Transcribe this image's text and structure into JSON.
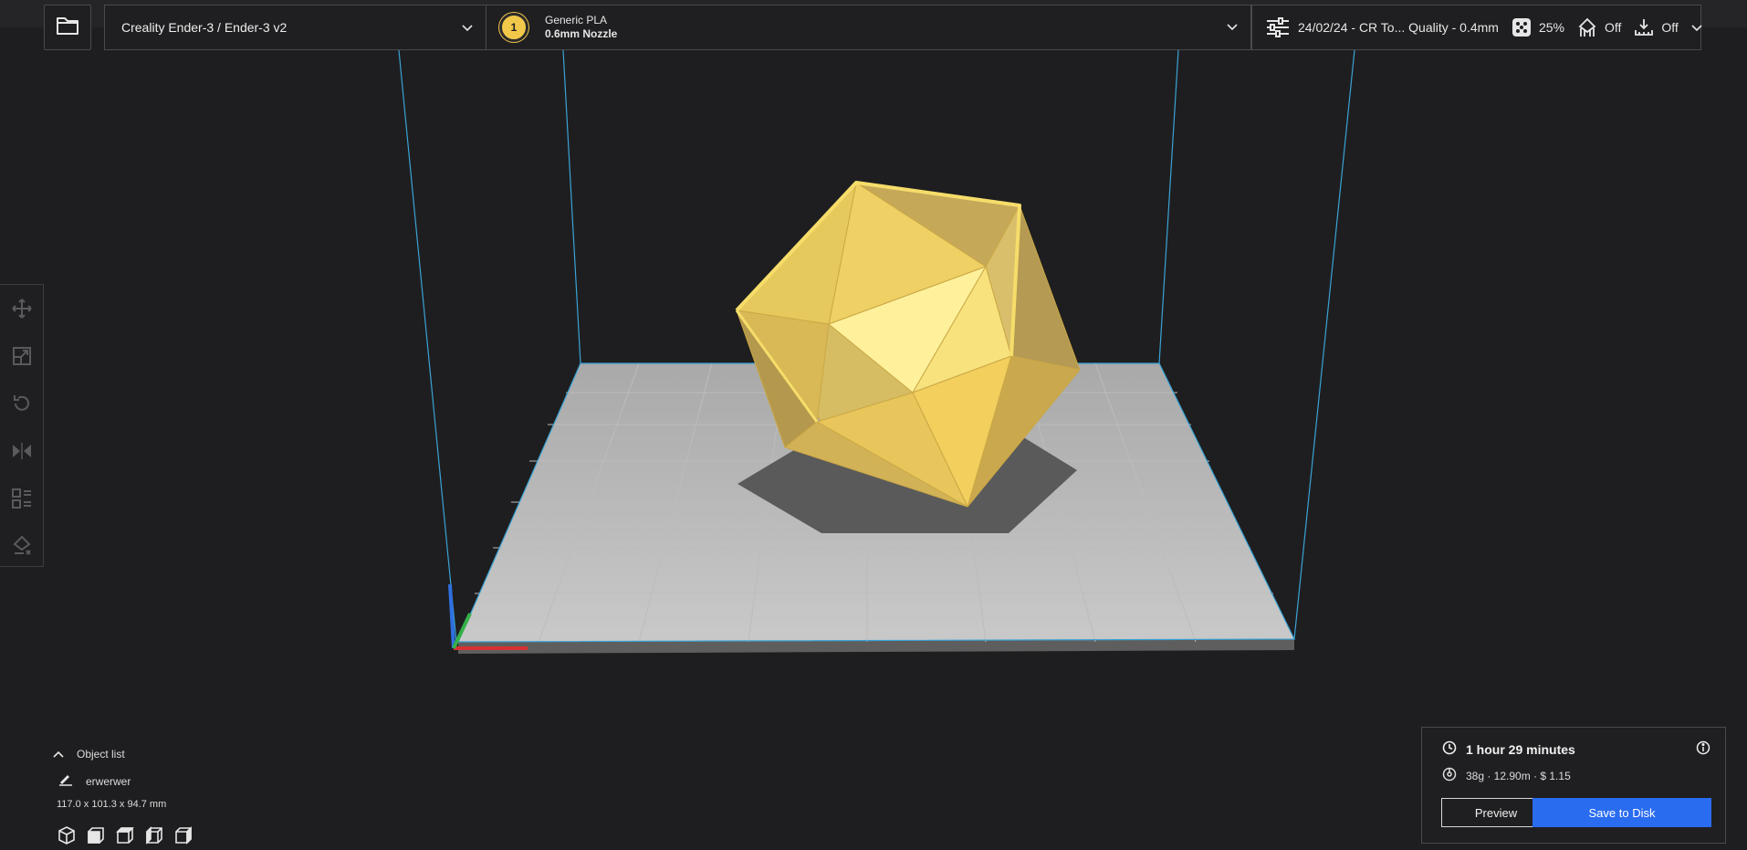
{
  "topbar": {
    "printer": "Creality Ender-3 / Ender-3 v2",
    "extruder_number": "1",
    "material": "Generic PLA",
    "nozzle": "0.6mm Nozzle",
    "profile": "24/02/24 - CR To... Quality - 0.4mm",
    "infill": "25%",
    "support": "Off",
    "adhesion": "Off"
  },
  "toolbar": {
    "tools": [
      "move-tool",
      "scale-tool",
      "rotate-tool",
      "mirror-tool",
      "per-model-settings-tool",
      "support-blocker-tool"
    ]
  },
  "object_list": {
    "header": "Object list",
    "object_name": "erwerwer",
    "dimensions": "117.0 x 101.3 x 94.7 mm"
  },
  "print_panel": {
    "time": "1 hour 29 minutes",
    "material_usage": "38g · 12.90m · $ 1.15",
    "preview_label": "Preview",
    "save_label": "Save to Disk"
  },
  "colors": {
    "background": "#1e1e20",
    "model": "#f0d36a",
    "build_volume_lines": "#3aa3d6",
    "accent_button": "#2a6cf0"
  }
}
